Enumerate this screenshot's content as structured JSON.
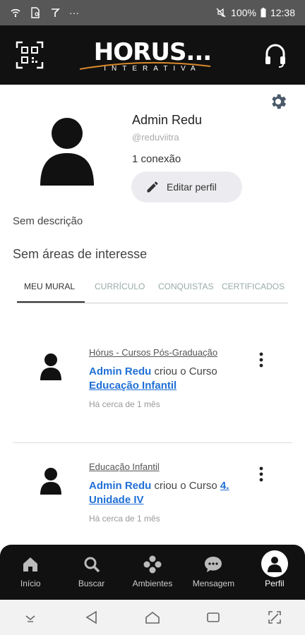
{
  "status_bar": {
    "battery": "100%",
    "time": "12:38",
    "overflow": "···"
  },
  "header": {
    "brand": "HORUS...",
    "tagline": "INTERATIVA"
  },
  "profile": {
    "name": "Admin Redu",
    "handle": "@reduviitra",
    "connections": "1 conexão",
    "edit_label": "Editar perfil",
    "description": "Sem descrição",
    "interests": "Sem áreas de interesse"
  },
  "tabs": [
    {
      "label": "MEU MURAL",
      "active": true
    },
    {
      "label": "CURRÍCULO"
    },
    {
      "label": "CONQUISTAS"
    },
    {
      "label": "CERTIFICADOS"
    }
  ],
  "posts": [
    {
      "source": "Hórus - Cursos Pós-Graduação",
      "who": "Admin Redu",
      "action": "criou o Curso",
      "course": "Educação Infantil",
      "time": "Há cerca de 1 mês"
    },
    {
      "source": "Educação Infantil",
      "who": "Admin Redu",
      "action": "criou o Curso",
      "course": "4. Unidade IV",
      "time": "Há cerca de 1 mês"
    }
  ],
  "bottom_nav": [
    {
      "label": "Início",
      "icon": "home-icon"
    },
    {
      "label": "Buscar",
      "icon": "search-icon"
    },
    {
      "label": "Ambientes",
      "icon": "ambientes-icon"
    },
    {
      "label": "Mensagem",
      "icon": "message-icon"
    },
    {
      "label": "Perfil",
      "icon": "person-icon",
      "active": true
    }
  ],
  "colors": {
    "header_bg": "#111111",
    "link": "#1f6fd6",
    "status_bg": "#575757"
  }
}
